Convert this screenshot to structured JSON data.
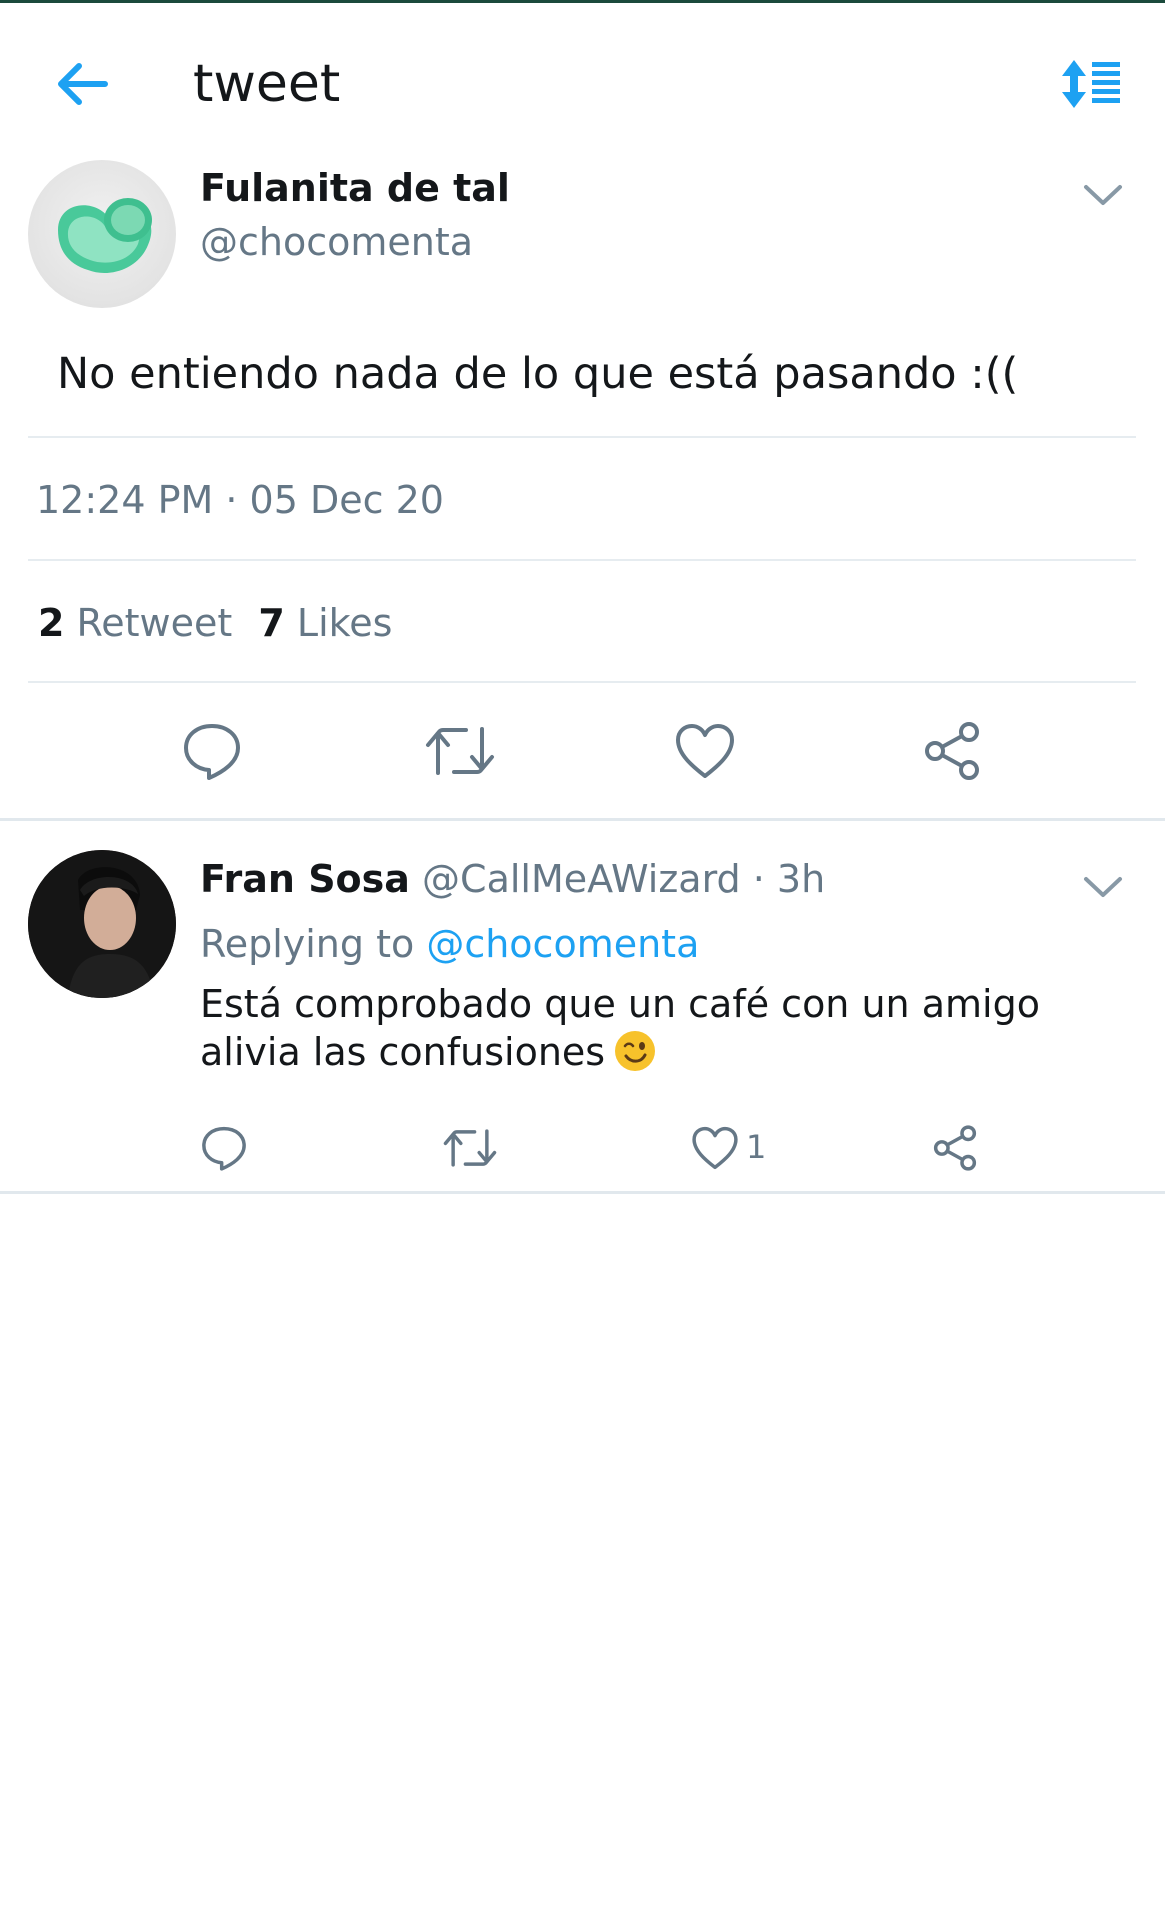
{
  "header": {
    "title": "tweet",
    "back_icon": "arrow-left-icon",
    "sort_icon": "sort-list-icon",
    "accent": "#1da1f2"
  },
  "tweet": {
    "author_name": "Fulanita de tal",
    "author_handle": "@chocomenta",
    "text": "No entiendo nada de lo que está pasando :((",
    "timestamp": "12:24 PM · 05 Dec 20",
    "retweets_count": "2",
    "retweets_label": "Retweet",
    "likes_count": "7",
    "likes_label": "Likes",
    "actions": [
      "reply-icon",
      "retweet-icon",
      "like-icon",
      "share-icon"
    ]
  },
  "reply": {
    "author_name": "Fran Sosa",
    "author_handle": "@CallMeAWizard",
    "time": "· 3h",
    "replying_label": "Replying to",
    "replying_to": "@chocomenta",
    "text": "Está comprobado que un café con un amigo alivia las confusiones",
    "emoji": "winking-face-emoji",
    "like_count": "1",
    "actions": [
      "reply-icon",
      "retweet-icon",
      "like-icon",
      "share-icon"
    ]
  },
  "colors": {
    "text_primary": "#14171a",
    "text_secondary": "#657786",
    "link": "#1da1f2",
    "divider": "#e6ecf0"
  }
}
